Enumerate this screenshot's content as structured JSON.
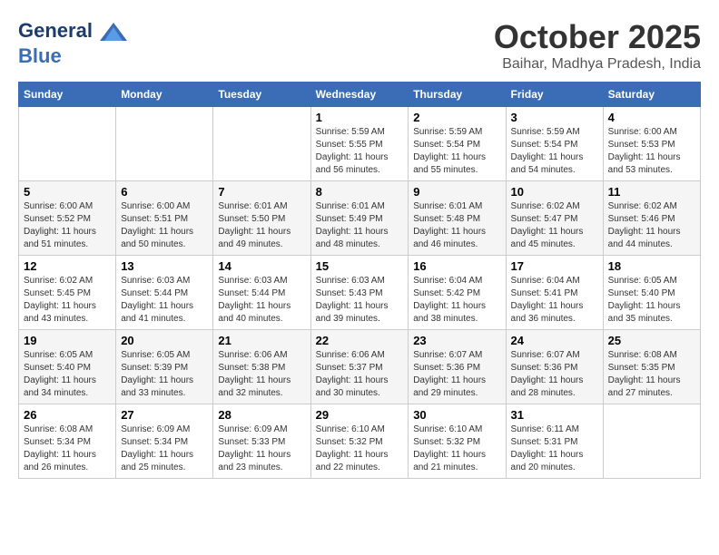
{
  "header": {
    "logo_line1": "General",
    "logo_line2": "Blue",
    "month_title": "October 2025",
    "location": "Baihar, Madhya Pradesh, India"
  },
  "weekdays": [
    "Sunday",
    "Monday",
    "Tuesday",
    "Wednesday",
    "Thursday",
    "Friday",
    "Saturday"
  ],
  "weeks": [
    [
      {
        "day": "",
        "info": ""
      },
      {
        "day": "",
        "info": ""
      },
      {
        "day": "",
        "info": ""
      },
      {
        "day": "1",
        "info": "Sunrise: 5:59 AM\nSunset: 5:55 PM\nDaylight: 11 hours and 56 minutes."
      },
      {
        "day": "2",
        "info": "Sunrise: 5:59 AM\nSunset: 5:54 PM\nDaylight: 11 hours and 55 minutes."
      },
      {
        "day": "3",
        "info": "Sunrise: 5:59 AM\nSunset: 5:54 PM\nDaylight: 11 hours and 54 minutes."
      },
      {
        "day": "4",
        "info": "Sunrise: 6:00 AM\nSunset: 5:53 PM\nDaylight: 11 hours and 53 minutes."
      }
    ],
    [
      {
        "day": "5",
        "info": "Sunrise: 6:00 AM\nSunset: 5:52 PM\nDaylight: 11 hours and 51 minutes."
      },
      {
        "day": "6",
        "info": "Sunrise: 6:00 AM\nSunset: 5:51 PM\nDaylight: 11 hours and 50 minutes."
      },
      {
        "day": "7",
        "info": "Sunrise: 6:01 AM\nSunset: 5:50 PM\nDaylight: 11 hours and 49 minutes."
      },
      {
        "day": "8",
        "info": "Sunrise: 6:01 AM\nSunset: 5:49 PM\nDaylight: 11 hours and 48 minutes."
      },
      {
        "day": "9",
        "info": "Sunrise: 6:01 AM\nSunset: 5:48 PM\nDaylight: 11 hours and 46 minutes."
      },
      {
        "day": "10",
        "info": "Sunrise: 6:02 AM\nSunset: 5:47 PM\nDaylight: 11 hours and 45 minutes."
      },
      {
        "day": "11",
        "info": "Sunrise: 6:02 AM\nSunset: 5:46 PM\nDaylight: 11 hours and 44 minutes."
      }
    ],
    [
      {
        "day": "12",
        "info": "Sunrise: 6:02 AM\nSunset: 5:45 PM\nDaylight: 11 hours and 43 minutes."
      },
      {
        "day": "13",
        "info": "Sunrise: 6:03 AM\nSunset: 5:44 PM\nDaylight: 11 hours and 41 minutes."
      },
      {
        "day": "14",
        "info": "Sunrise: 6:03 AM\nSunset: 5:44 PM\nDaylight: 11 hours and 40 minutes."
      },
      {
        "day": "15",
        "info": "Sunrise: 6:03 AM\nSunset: 5:43 PM\nDaylight: 11 hours and 39 minutes."
      },
      {
        "day": "16",
        "info": "Sunrise: 6:04 AM\nSunset: 5:42 PM\nDaylight: 11 hours and 38 minutes."
      },
      {
        "day": "17",
        "info": "Sunrise: 6:04 AM\nSunset: 5:41 PM\nDaylight: 11 hours and 36 minutes."
      },
      {
        "day": "18",
        "info": "Sunrise: 6:05 AM\nSunset: 5:40 PM\nDaylight: 11 hours and 35 minutes."
      }
    ],
    [
      {
        "day": "19",
        "info": "Sunrise: 6:05 AM\nSunset: 5:40 PM\nDaylight: 11 hours and 34 minutes."
      },
      {
        "day": "20",
        "info": "Sunrise: 6:05 AM\nSunset: 5:39 PM\nDaylight: 11 hours and 33 minutes."
      },
      {
        "day": "21",
        "info": "Sunrise: 6:06 AM\nSunset: 5:38 PM\nDaylight: 11 hours and 32 minutes."
      },
      {
        "day": "22",
        "info": "Sunrise: 6:06 AM\nSunset: 5:37 PM\nDaylight: 11 hours and 30 minutes."
      },
      {
        "day": "23",
        "info": "Sunrise: 6:07 AM\nSunset: 5:36 PM\nDaylight: 11 hours and 29 minutes."
      },
      {
        "day": "24",
        "info": "Sunrise: 6:07 AM\nSunset: 5:36 PM\nDaylight: 11 hours and 28 minutes."
      },
      {
        "day": "25",
        "info": "Sunrise: 6:08 AM\nSunset: 5:35 PM\nDaylight: 11 hours and 27 minutes."
      }
    ],
    [
      {
        "day": "26",
        "info": "Sunrise: 6:08 AM\nSunset: 5:34 PM\nDaylight: 11 hours and 26 minutes."
      },
      {
        "day": "27",
        "info": "Sunrise: 6:09 AM\nSunset: 5:34 PM\nDaylight: 11 hours and 25 minutes."
      },
      {
        "day": "28",
        "info": "Sunrise: 6:09 AM\nSunset: 5:33 PM\nDaylight: 11 hours and 23 minutes."
      },
      {
        "day": "29",
        "info": "Sunrise: 6:10 AM\nSunset: 5:32 PM\nDaylight: 11 hours and 22 minutes."
      },
      {
        "day": "30",
        "info": "Sunrise: 6:10 AM\nSunset: 5:32 PM\nDaylight: 11 hours and 21 minutes."
      },
      {
        "day": "31",
        "info": "Sunrise: 6:11 AM\nSunset: 5:31 PM\nDaylight: 11 hours and 20 minutes."
      },
      {
        "day": "",
        "info": ""
      }
    ]
  ]
}
